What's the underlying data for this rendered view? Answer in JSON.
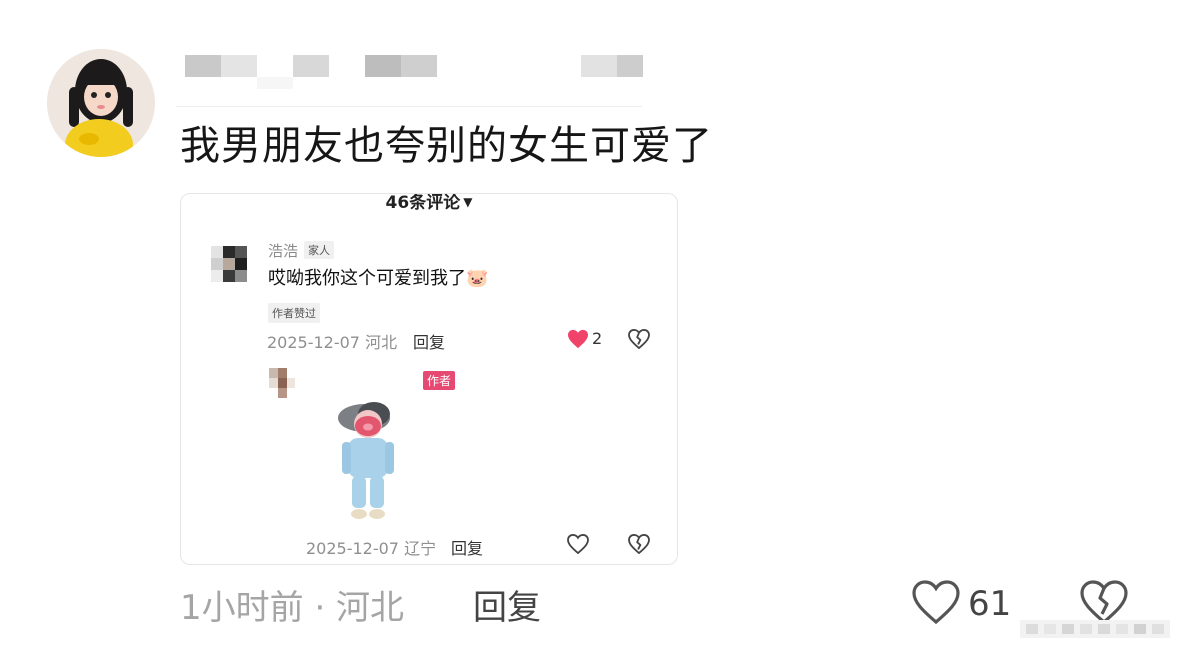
{
  "post": {
    "comment_text": "我男朋友也夸别的女生可爱了",
    "time_location": "1小时前 · 河北",
    "reply_label": "回复",
    "like_count": "61"
  },
  "embedded": {
    "header": "46条评论",
    "comment1": {
      "username": "浩浩",
      "tag": "家人",
      "text": "哎呦我你这个可爱到我了🐷",
      "badge": "作者赞过",
      "date_loc": "2025-12-07 河北",
      "reply_label": "回复",
      "likes": "2"
    },
    "comment2": {
      "author_tag": "作者",
      "date_loc": "2025-12-07 辽宁",
      "reply_label": "回复"
    }
  },
  "colors": {
    "like_red": "#f0436a",
    "author_tag": "#e64a72",
    "meta_gray": "#a5a5a5"
  },
  "icons": [
    "heart-icon",
    "broken-heart-icon",
    "caret-down-icon",
    "pig-emoji"
  ]
}
